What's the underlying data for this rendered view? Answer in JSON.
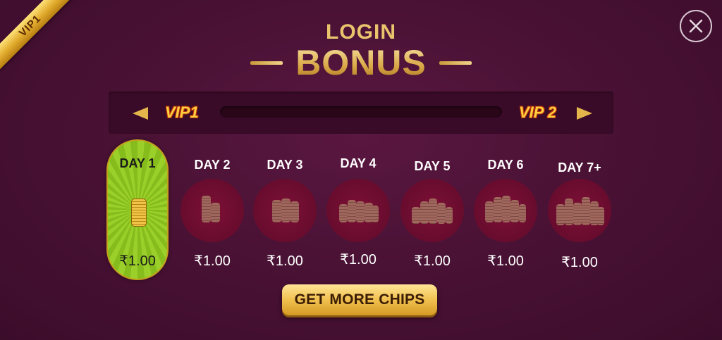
{
  "ribbon": {
    "label": "VIP1"
  },
  "title": {
    "top": "LOGIN",
    "main": "BONUS"
  },
  "vip_progress": {
    "current_label": "VIP1",
    "next_label": "VIP 2",
    "progress": 0
  },
  "days": [
    {
      "label": "DAY 1",
      "amount": "₹1.00",
      "active": true,
      "stack_icon": "coin-stack-icon"
    },
    {
      "label": "DAY 2",
      "amount": "₹1.00",
      "active": false,
      "stack_icon": "coin-stacks-icon"
    },
    {
      "label": "DAY 3",
      "amount": "₹1.00",
      "active": false,
      "stack_icon": "coin-stacks-icon"
    },
    {
      "label": "DAY 4",
      "amount": "₹1.00",
      "active": false,
      "stack_icon": "coin-stacks-icon"
    },
    {
      "label": "DAY 5",
      "amount": "₹1.00",
      "active": false,
      "stack_icon": "coin-stacks-icon"
    },
    {
      "label": "DAY 6",
      "amount": "₹1.00",
      "active": false,
      "stack_icon": "coin-stacks-icon"
    },
    {
      "label": "DAY 7+",
      "amount": "₹1.00",
      "active": false,
      "stack_icon": "coin-stacks-icon"
    }
  ],
  "cta": {
    "label": "GET MORE CHIPS"
  },
  "icons": {
    "close": "close-icon",
    "prev": "arrow-left-icon",
    "next": "arrow-right-icon"
  },
  "colors": {
    "background": "#4a1235",
    "gold": "#e8c265",
    "active_day": "#9bd02a",
    "coin_circle": "#6a0c2f",
    "vip_text": "#ffcf3f"
  }
}
